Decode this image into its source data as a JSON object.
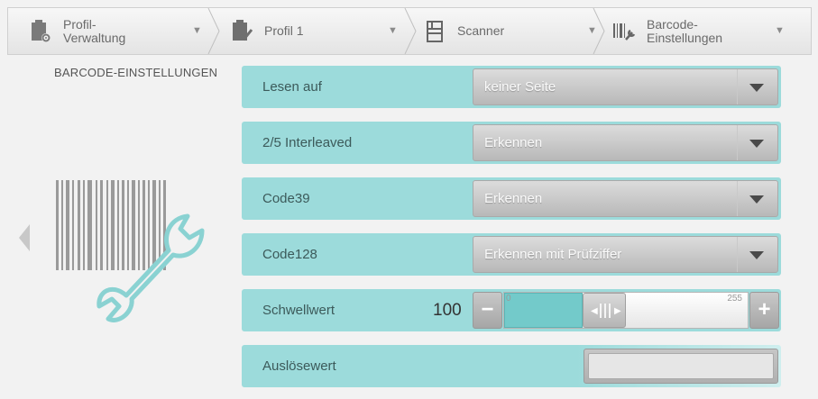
{
  "breadcrumb": [
    {
      "label": "Profil-\nVerwaltung",
      "icon": "profile-management-icon"
    },
    {
      "label": "Profil 1",
      "icon": "clipboard-check-icon"
    },
    {
      "label": "Scanner",
      "icon": "scanner-icon"
    },
    {
      "label": "Barcode-\nEinstellungen",
      "icon": "barcode-settings-icon"
    }
  ],
  "sidebar": {
    "title": "BARCODE-EINSTELLUNGEN",
    "illustration_icon": "barcode-wrench-icon"
  },
  "settings": [
    {
      "label": "Lesen auf",
      "value": "keiner Seite"
    },
    {
      "label": "2/5 Interleaved",
      "value": "Erkennen"
    },
    {
      "label": "Code39",
      "value": "Erkennen"
    },
    {
      "label": "Code128",
      "value": "Erkennen mit Prüfziffer"
    }
  ],
  "threshold": {
    "label": "Schwellwert",
    "value": "100",
    "min_label": "0",
    "max_label": "255",
    "minus": "−",
    "plus": "+",
    "position_fraction": 0.39
  },
  "trigger": {
    "label": "Auslösewert",
    "value": ""
  },
  "colors": {
    "accent": "#9cdbdb",
    "slider_fill": "#73caca"
  }
}
